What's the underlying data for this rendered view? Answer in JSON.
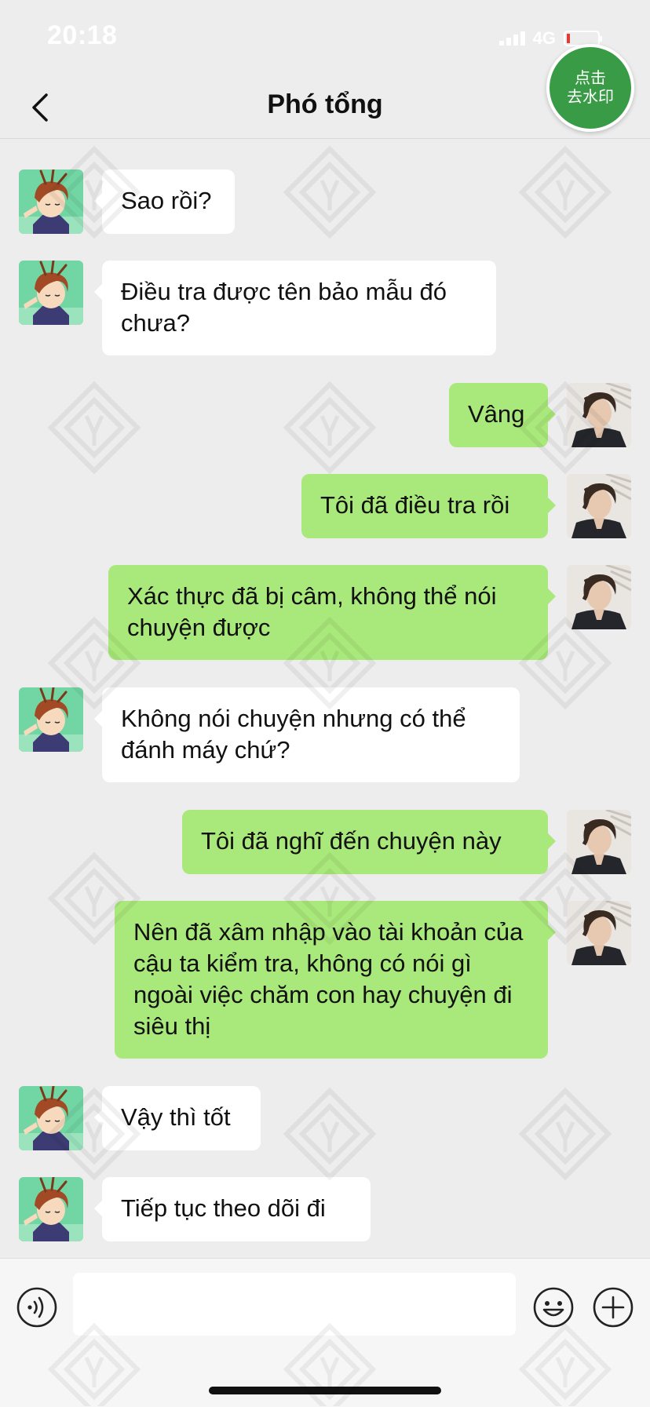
{
  "status_bar": {
    "time": "20:18",
    "network": "4G"
  },
  "nav": {
    "title": "Phó tổng"
  },
  "watermark": {
    "line1": "点击",
    "line2": "去水印"
  },
  "messages": [
    {
      "side": "in",
      "text": "Sao rồi?"
    },
    {
      "side": "in",
      "text": "Điều tra được tên bảo mẫu đó chưa?"
    },
    {
      "side": "out",
      "text": "Vâng"
    },
    {
      "side": "out",
      "text": "Tôi đã điều tra rồi"
    },
    {
      "side": "out",
      "text": "Xác thực đã bị câm, không thể nói chuyện được"
    },
    {
      "side": "in",
      "text": "Không nói chuyện nhưng có thể đánh máy chứ?"
    },
    {
      "side": "out",
      "text": "Tôi đã nghĩ đến chuyện này"
    },
    {
      "side": "out",
      "text": "Nên đã xâm nhập vào tài khoản của cậu ta kiểm tra, không có nói gì ngoài việc chăm con hay chuyện đi siêu thị"
    },
    {
      "side": "in",
      "text": "Vậy thì tốt"
    },
    {
      "side": "in",
      "text": "Tiếp tục theo dõi đi"
    }
  ],
  "input": {
    "value": ""
  },
  "icons": {
    "back": "chevron-left-icon",
    "voice": "voice-icon",
    "emoji": "emoji-icon",
    "plus": "plus-icon",
    "incoming_avatar": "cartoon-girl-avatar",
    "outgoing_avatar": "man-portrait-avatar"
  },
  "colors": {
    "background": "#ededed",
    "incoming_bubble": "#ffffff",
    "outgoing_bubble": "#a9e87a",
    "badge": "#3a9b47"
  }
}
